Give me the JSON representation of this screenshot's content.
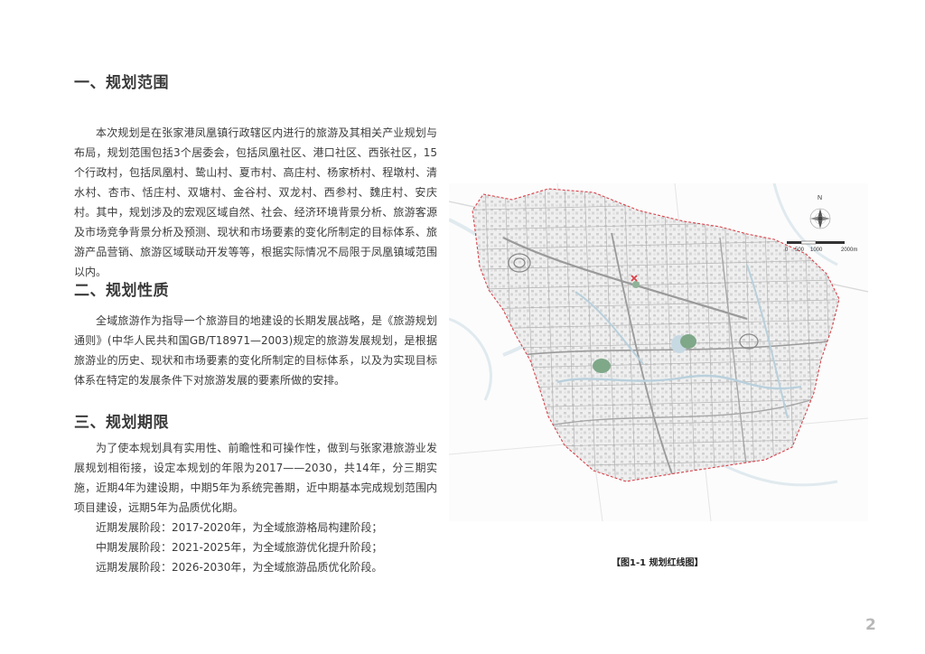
{
  "sections": [
    {
      "heading": "一、规划范围",
      "paragraph": "本次规划是在张家港凤凰镇行政辖区内进行的旅游及其相关产业规划与布局，规划范围包括3个居委会，包括凤凰社区、港口社区、西张社区，15个行政村，包括凤凰村、鸷山村、夏市村、高庄村、杨家桥村、程墩村、清水村、杏市、恬庄村、双塘村、金谷村、双龙村、西参村、魏庄村、安庆村。其中，规划涉及的宏观区域自然、社会、经济环境背景分析、旅游客源及市场竞争背景分析及预测、现状和市场要素的变化所制定的目标体系、旅游产品营销、旅游区域联动开发等等，根据实际情况不局限于凤凰镇域范围以内。"
    },
    {
      "heading": "二、规划性质",
      "paragraph": "全域旅游作为指导一个旅游目的地建设的长期发展战略，是《旅游规划通则》(中华人民共和国GB/T18971—2003)规定的旅游发展规划，是根据旅游业的历史、现状和市场要素的变化所制定的目标体系，以及为实现目标体系在特定的发展条件下对旅游发展的要素所做的安排。"
    },
    {
      "heading": "三、规划期限",
      "paragraph": "为了使本规划具有实用性、前瞻性和可操作性，做到与张家港旅游业发展规划相衔接，设定本规划的年限为2017——2030，共14年，分三期实施，近期4年为建设期，中期5年为系统完善期，近中期基本完成规划范围内项目建设，远期5年为品质优化期。"
    }
  ],
  "phases": [
    "近期发展阶段：2017-2020年，为全域旅游格局构建阶段；",
    "中期发展阶段：2021-2025年，为全域旅游优化提升阶段；",
    "远期发展阶段：2026-2030年，为全域旅游品质优化阶段。"
  ],
  "map": {
    "north_label": "N",
    "scale_labels": [
      "0",
      "500",
      "1000",
      "2000m"
    ],
    "boundary_color": "#d9434b",
    "water_color": "#c7d9e3",
    "park_color": "#7fa889"
  },
  "caption": "【图1-1  规划红线图】",
  "page_number": "2"
}
